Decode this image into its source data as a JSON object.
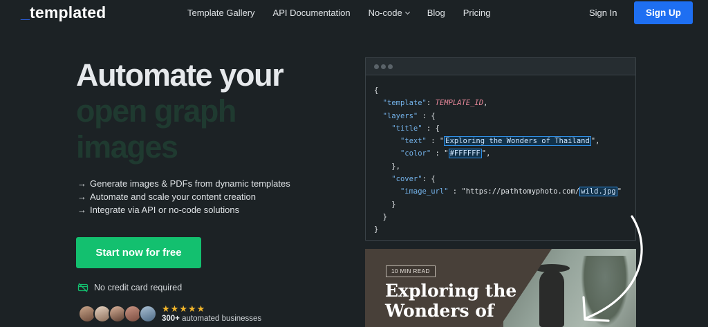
{
  "nav": {
    "logo": "templated",
    "links": [
      {
        "label": "Template Gallery"
      },
      {
        "label": "API Documentation"
      },
      {
        "label": "No-code",
        "has_dropdown": true
      },
      {
        "label": "Blog"
      },
      {
        "label": "Pricing"
      }
    ],
    "sign_in": "Sign In",
    "sign_up": "Sign Up"
  },
  "hero": {
    "title_line1": "Automate your",
    "title_line2": "open graph",
    "title_line3": "images",
    "features": [
      "Generate images & PDFs from dynamic templates",
      "Automate and scale your content creation",
      "Integrate via API or no-code solutions"
    ],
    "cta": "Start now for free",
    "no_credit_card": "No credit card required",
    "rating_stars": 5,
    "businesses_count": "300+",
    "businesses_label": "automated businesses"
  },
  "code": {
    "template_key": "\"template\"",
    "template_value": "TEMPLATE_ID",
    "layers_key": "\"layers\"",
    "title_key": "\"title\"",
    "text_key": "\"text\"",
    "text_value": "Exploring the Wonders of Thailand",
    "color_key": "\"color\"",
    "color_value": "#FFFFFF",
    "cover_key": "\"cover\"",
    "image_url_key": "\"image_url\"",
    "image_url_prefix": "https://pathtomyphoto.com/",
    "image_url_file": "wild.jpg"
  },
  "preview": {
    "badge": "10 MIN READ",
    "title": "Exploring the Wonders of"
  },
  "colors": {
    "background": "#1c2225",
    "primary_blue": "#1e6ff2",
    "cta_green": "#13c06f",
    "star_gold": "#f3b62a",
    "code_key": "#74b3ea",
    "code_highlight_border": "#2f8fe6"
  }
}
